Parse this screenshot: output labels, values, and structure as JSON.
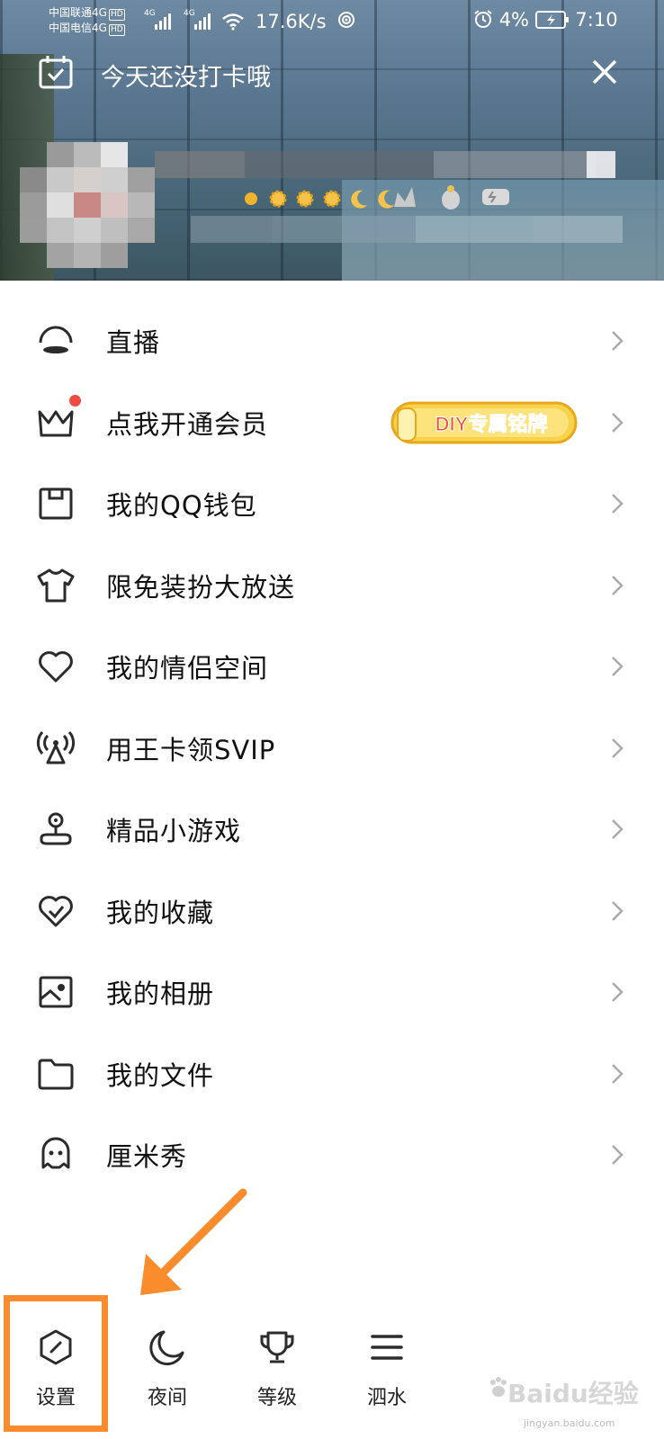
{
  "status_bar": {
    "carrier_1": "中国联通4G",
    "carrier_2": "中国电信4G",
    "hd": "HD",
    "net_type": "4G",
    "speed": "17.6K/s",
    "battery": "4%",
    "time": "7:10"
  },
  "header": {
    "checkin_text": "今天还没打卡哦"
  },
  "menu": {
    "items": [
      {
        "label": "直播",
        "icon": "live-icon"
      },
      {
        "label": "点我开通会员",
        "icon": "crown-icon",
        "promo": "DIY专属铭牌"
      },
      {
        "label": "我的QQ钱包",
        "icon": "wallet-icon"
      },
      {
        "label": "限免装扮大放送",
        "icon": "tshirt-icon"
      },
      {
        "label": "我的情侣空间",
        "icon": "heart-icon"
      },
      {
        "label": "用王卡领SVIP",
        "icon": "antenna-icon"
      },
      {
        "label": "精品小游戏",
        "icon": "joystick-icon"
      },
      {
        "label": "我的收藏",
        "icon": "favorite-icon"
      },
      {
        "label": "我的相册",
        "icon": "album-icon"
      },
      {
        "label": "我的文件",
        "icon": "folder-icon"
      },
      {
        "label": "厘米秀",
        "icon": "cmshow-icon"
      }
    ]
  },
  "bottom_bar": {
    "settings": "设置",
    "night": "夜间",
    "level": "等级",
    "drip": "泗水"
  },
  "watermark": {
    "main": "Baidu经验",
    "sub": "jingyan.baidu.com"
  },
  "colors": {
    "annotation": "#fa8c2e",
    "badge": "#f04b42",
    "icon_stroke": "#2b2b2b"
  }
}
